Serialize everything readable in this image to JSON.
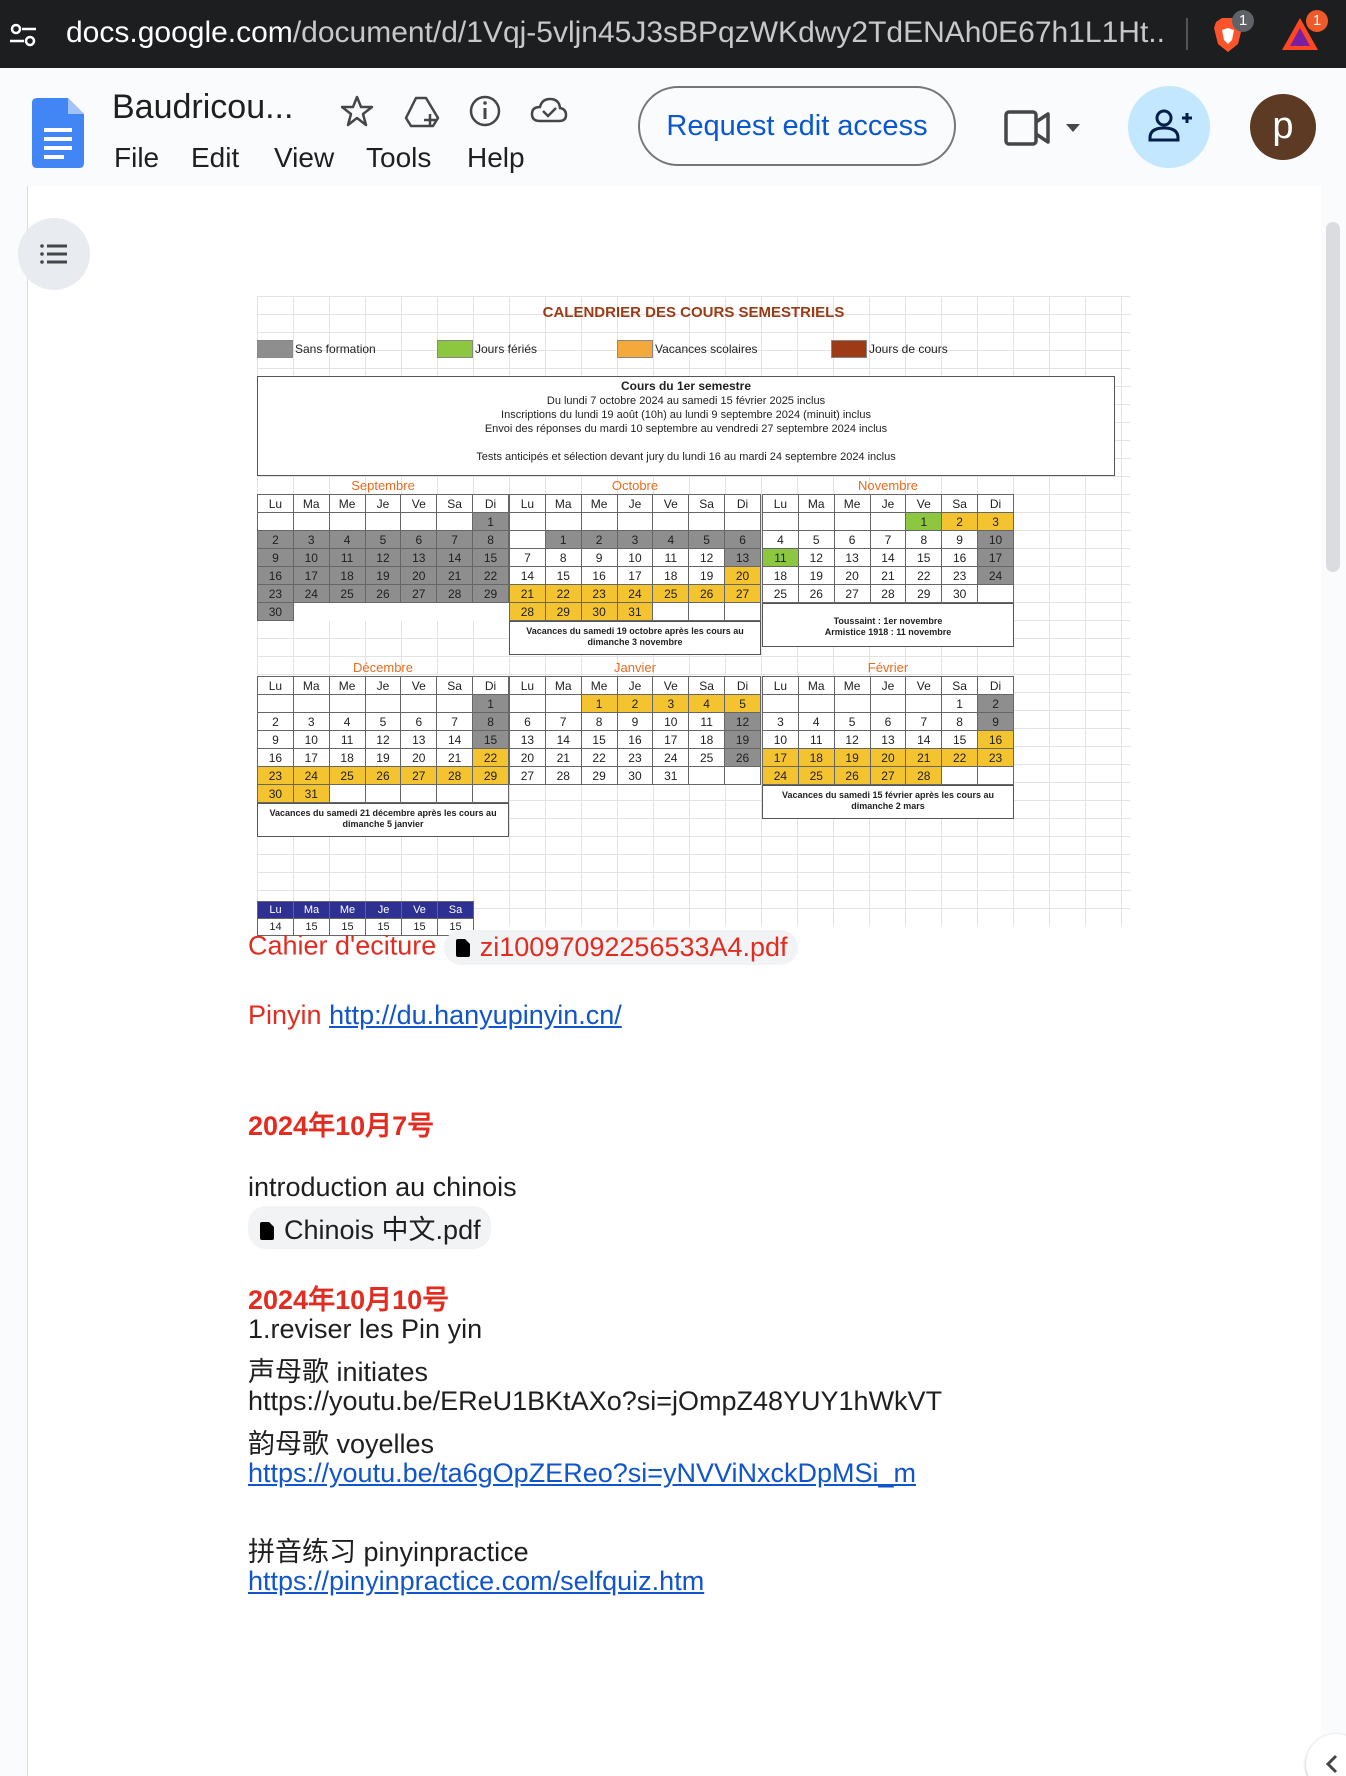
{
  "browser": {
    "url_host": "docs.google.com",
    "url_path": "/document/d/1Vqj-5vljn45J3sBPqzWKdwy2TdENAh0E67h1L1Ht...",
    "brave_badge": "1",
    "rewards_badge": "1"
  },
  "docs": {
    "title": "Baudricou...",
    "menu": [
      "File",
      "Edit",
      "View",
      "Tools",
      "Help"
    ],
    "request_button": "Request edit access",
    "avatar_letter": "p"
  },
  "calendar": {
    "title": "CALENDRIER DES COURS SEMESTRIELS",
    "legend": [
      "Sans formation",
      "Jours fériés",
      "Vacances scolaires",
      "Jours de cours"
    ],
    "legend_colors": [
      "#8e8e8e",
      "#8dc63f",
      "#f4a93a",
      "#9c3b16"
    ],
    "info_title": "Cours du 1er semestre",
    "info_lines": [
      "Du lundi 7 octobre 2024 au samedi 15 février 2025 inclus",
      "Inscriptions du lundi 19 août (10h) au lundi 9 septembre 2024 (minuit) inclus",
      "Envoi des réponses du mardi 10 septembre au vendredi 27 septembre 2024 inclus",
      "Tests anticipés et sélection devant jury du lundi 16 au mardi 24 septembre 2024 inclus"
    ],
    "day_headers": [
      "Lu",
      "Ma",
      "Me",
      "Je",
      "Ve",
      "Sa",
      "Di"
    ],
    "months": [
      {
        "name": "Septembre",
        "rows": [
          [
            [
              "",
              ""
            ],
            [
              "",
              ""
            ],
            [
              "",
              ""
            ],
            [
              "",
              ""
            ],
            [
              "",
              ""
            ],
            [
              "",
              ""
            ],
            [
              "1",
              "g"
            ]
          ],
          [
            [
              "2",
              "g"
            ],
            [
              "3",
              "g"
            ],
            [
              "4",
              "g"
            ],
            [
              "5",
              "g"
            ],
            [
              "6",
              "g"
            ],
            [
              "7",
              "g"
            ],
            [
              "8",
              "g"
            ]
          ],
          [
            [
              "9",
              "g"
            ],
            [
              "10",
              "g"
            ],
            [
              "11",
              "g"
            ],
            [
              "12",
              "g"
            ],
            [
              "13",
              "g"
            ],
            [
              "14",
              "g"
            ],
            [
              "15",
              "g"
            ]
          ],
          [
            [
              "16",
              "g"
            ],
            [
              "17",
              "g"
            ],
            [
              "18",
              "g"
            ],
            [
              "19",
              "g"
            ],
            [
              "20",
              "g"
            ],
            [
              "21",
              "g"
            ],
            [
              "22",
              "g"
            ]
          ],
          [
            [
              "23",
              "g"
            ],
            [
              "24",
              "g"
            ],
            [
              "25",
              "g"
            ],
            [
              "26",
              "g"
            ],
            [
              "27",
              "g"
            ],
            [
              "28",
              "g"
            ],
            [
              "29",
              "g"
            ]
          ],
          [
            [
              "30",
              "g"
            ]
          ]
        ],
        "note": ""
      },
      {
        "name": "Octobre",
        "rows": [
          [
            [
              "",
              ""
            ],
            [
              "",
              ""
            ],
            [
              "",
              ""
            ],
            [
              "",
              ""
            ],
            [
              "",
              ""
            ],
            [
              "",
              ""
            ],
            [
              "",
              ""
            ]
          ],
          [
            [
              "",
              ""
            ],
            [
              "1",
              "g"
            ],
            [
              "2",
              "g"
            ],
            [
              "3",
              "g"
            ],
            [
              "4",
              "g"
            ],
            [
              "5",
              "g"
            ],
            [
              "6",
              "g"
            ]
          ],
          [
            [
              "7",
              ""
            ],
            [
              "8",
              ""
            ],
            [
              "9",
              ""
            ],
            [
              "10",
              ""
            ],
            [
              "11",
              ""
            ],
            [
              "12",
              ""
            ],
            [
              "13",
              "g"
            ]
          ],
          [
            [
              "14",
              ""
            ],
            [
              "15",
              ""
            ],
            [
              "16",
              ""
            ],
            [
              "17",
              ""
            ],
            [
              "18",
              ""
            ],
            [
              "19",
              ""
            ],
            [
              "20",
              "y"
            ]
          ],
          [
            [
              "21",
              "y"
            ],
            [
              "22",
              "y"
            ],
            [
              "23",
              "y"
            ],
            [
              "24",
              "y"
            ],
            [
              "25",
              "y"
            ],
            [
              "26",
              "y"
            ],
            [
              "27",
              "y"
            ]
          ],
          [
            [
              "28",
              "y"
            ],
            [
              "29",
              "y"
            ],
            [
              "30",
              "y"
            ],
            [
              "31",
              "y"
            ],
            [
              "",
              ""
            ],
            [
              "",
              ""
            ],
            [
              "",
              ""
            ]
          ]
        ],
        "note": "Vacances du samedi 19 octobre après les cours au dimanche 3 novembre"
      },
      {
        "name": "Novembre",
        "rows": [
          [
            [
              "",
              ""
            ],
            [
              "",
              ""
            ],
            [
              "",
              ""
            ],
            [
              "",
              ""
            ],
            [
              "1",
              "l"
            ],
            [
              "2",
              "y"
            ],
            [
              "3",
              "y"
            ]
          ],
          [
            [
              "4",
              ""
            ],
            [
              "5",
              ""
            ],
            [
              "6",
              ""
            ],
            [
              "7",
              ""
            ],
            [
              "8",
              ""
            ],
            [
              "9",
              ""
            ],
            [
              "10",
              "g"
            ]
          ],
          [
            [
              "11",
              "l"
            ],
            [
              "12",
              ""
            ],
            [
              "13",
              ""
            ],
            [
              "14",
              ""
            ],
            [
              "15",
              ""
            ],
            [
              "16",
              ""
            ],
            [
              "17",
              "g"
            ]
          ],
          [
            [
              "18",
              ""
            ],
            [
              "19",
              ""
            ],
            [
              "20",
              ""
            ],
            [
              "21",
              ""
            ],
            [
              "22",
              ""
            ],
            [
              "23",
              ""
            ],
            [
              "24",
              "g"
            ]
          ],
          [
            [
              "25",
              ""
            ],
            [
              "26",
              ""
            ],
            [
              "27",
              ""
            ],
            [
              "28",
              ""
            ],
            [
              "29",
              ""
            ],
            [
              "30",
              ""
            ],
            [
              "",
              ""
            ]
          ]
        ],
        "note": "Toussaint : 1er novembre\nArmistice 1918 : 11 novembre"
      },
      {
        "name": "Décembre",
        "rows": [
          [
            [
              "",
              ""
            ],
            [
              "",
              ""
            ],
            [
              "",
              ""
            ],
            [
              "",
              ""
            ],
            [
              "",
              ""
            ],
            [
              "",
              ""
            ],
            [
              "1",
              "g"
            ]
          ],
          [
            [
              "2",
              ""
            ],
            [
              "3",
              ""
            ],
            [
              "4",
              ""
            ],
            [
              "5",
              ""
            ],
            [
              "6",
              ""
            ],
            [
              "7",
              ""
            ],
            [
              "8",
              "g"
            ]
          ],
          [
            [
              "9",
              ""
            ],
            [
              "10",
              ""
            ],
            [
              "11",
              ""
            ],
            [
              "12",
              ""
            ],
            [
              "13",
              ""
            ],
            [
              "14",
              ""
            ],
            [
              "15",
              "g"
            ]
          ],
          [
            [
              "16",
              ""
            ],
            [
              "17",
              ""
            ],
            [
              "18",
              ""
            ],
            [
              "19",
              ""
            ],
            [
              "20",
              ""
            ],
            [
              "21",
              ""
            ],
            [
              "22",
              "y"
            ]
          ],
          [
            [
              "23",
              "y"
            ],
            [
              "24",
              "y"
            ],
            [
              "25",
              "y"
            ],
            [
              "26",
              "y"
            ],
            [
              "27",
              "y"
            ],
            [
              "28",
              "y"
            ],
            [
              "29",
              "y"
            ]
          ],
          [
            [
              "30",
              "y"
            ],
            [
              "31",
              "y"
            ],
            [
              "",
              ""
            ],
            [
              "",
              ""
            ],
            [
              "",
              ""
            ],
            [
              "",
              ""
            ],
            [
              "",
              ""
            ]
          ]
        ],
        "note": "Vacances du samedi 21 décembre après les cours au dimanche 5 janvier"
      },
      {
        "name": "Janvier",
        "rows": [
          [
            [
              "",
              ""
            ],
            [
              "",
              ""
            ],
            [
              "1",
              "y"
            ],
            [
              "2",
              "y"
            ],
            [
              "3",
              "y"
            ],
            [
              "4",
              "y"
            ],
            [
              "5",
              "y"
            ]
          ],
          [
            [
              "6",
              ""
            ],
            [
              "7",
              ""
            ],
            [
              "8",
              ""
            ],
            [
              "9",
              ""
            ],
            [
              "10",
              ""
            ],
            [
              "11",
              ""
            ],
            [
              "12",
              "g"
            ]
          ],
          [
            [
              "13",
              ""
            ],
            [
              "14",
              ""
            ],
            [
              "15",
              ""
            ],
            [
              "16",
              ""
            ],
            [
              "17",
              ""
            ],
            [
              "18",
              ""
            ],
            [
              "19",
              "g"
            ]
          ],
          [
            [
              "20",
              ""
            ],
            [
              "21",
              ""
            ],
            [
              "22",
              ""
            ],
            [
              "23",
              ""
            ],
            [
              "24",
              ""
            ],
            [
              "25",
              ""
            ],
            [
              "26",
              "g"
            ]
          ],
          [
            [
              "27",
              ""
            ],
            [
              "28",
              ""
            ],
            [
              "29",
              ""
            ],
            [
              "30",
              ""
            ],
            [
              "31",
              ""
            ],
            [
              "",
              ""
            ],
            [
              "",
              ""
            ]
          ]
        ],
        "note": ""
      },
      {
        "name": "Février",
        "rows": [
          [
            [
              "",
              ""
            ],
            [
              "",
              ""
            ],
            [
              "",
              ""
            ],
            [
              "",
              ""
            ],
            [
              "",
              ""
            ],
            [
              "1",
              ""
            ],
            [
              "2",
              "g"
            ]
          ],
          [
            [
              "3",
              ""
            ],
            [
              "4",
              ""
            ],
            [
              "5",
              ""
            ],
            [
              "6",
              ""
            ],
            [
              "7",
              ""
            ],
            [
              "8",
              ""
            ],
            [
              "9",
              "g"
            ]
          ],
          [
            [
              "10",
              ""
            ],
            [
              "11",
              ""
            ],
            [
              "12",
              ""
            ],
            [
              "13",
              ""
            ],
            [
              "14",
              ""
            ],
            [
              "15",
              ""
            ],
            [
              "16",
              "y"
            ]
          ],
          [
            [
              "17",
              "y"
            ],
            [
              "18",
              "y"
            ],
            [
              "19",
              "y"
            ],
            [
              "20",
              "y"
            ],
            [
              "21",
              "y"
            ],
            [
              "22",
              "y"
            ],
            [
              "23",
              "y"
            ]
          ],
          [
            [
              "24",
              "y"
            ],
            [
              "25",
              "y"
            ],
            [
              "26",
              "y"
            ],
            [
              "27",
              "y"
            ],
            [
              "28",
              "y"
            ],
            [
              "",
              ""
            ],
            [
              "",
              ""
            ]
          ]
        ],
        "note": "Vacances du samedi 15 février après les cours au dimanche 2 mars"
      }
    ],
    "week_headers": [
      "Lu",
      "Ma",
      "Me",
      "Je",
      "Ve",
      "Sa"
    ],
    "week_values": [
      "14",
      "15",
      "15",
      "15",
      "15",
      "15"
    ]
  },
  "content": {
    "cahier_label": "Cahier d'eciture",
    "cahier_file": "zi10097092256533A4.pdf",
    "pinyin_label": "Pinyin",
    "pinyin_link": "http://du.hanyupinyin.cn/",
    "date1": "2024年10月7号",
    "intro": "introduction au chinois",
    "chinois_file": "Chinois 中文.pdf",
    "date2": "2024年10月10号",
    "line1": "1.reviser les Pin yin",
    "line2": "声母歌 initiates",
    "line3": "https://youtu.be/EReU1BKtAXo?si=jOmpZ48YUY1hWkVT",
    "line4": "韵母歌 voyelles",
    "line5": "https://youtu.be/ta6gOpZEReo?si=yNVViNxckDpMSi_m",
    "line6": "拼音练习 pinyinpractice",
    "line7": "https://pinyinpractice.com/selfquiz.htm"
  }
}
